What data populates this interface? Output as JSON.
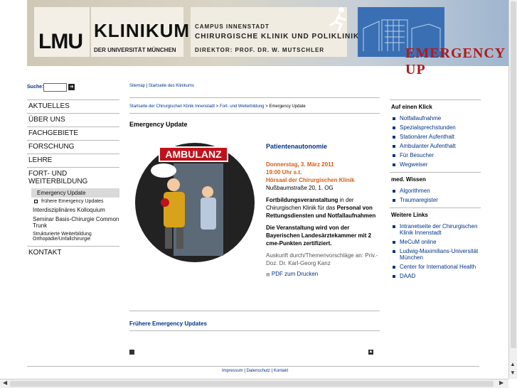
{
  "header": {
    "logo": "LMU",
    "klinikum": "KLINIKUM",
    "university": "DER UNIVERSITÄT MÜNCHEN",
    "campus": "CAMPUS INNENSTADT",
    "clinic": "CHIRURGISCHE KLINIK UND POLIKLINIK",
    "director": "DIREKTOR: PROF. DR. W. MUTSCHLER",
    "banner": "EMERGENCY UP"
  },
  "search": {
    "label": "Suche:",
    "value": ""
  },
  "nav": {
    "items": [
      "AKTUELLES",
      "ÜBER UNS",
      "FACHGEBIETE",
      "FORSCHUNG",
      "LEHRE",
      "FORT- UND WEITERBILDUNG"
    ],
    "sub": [
      "Emergency Update",
      "frühere Emergency Updates",
      "Interdisziplinäres Kolloquium",
      "Seminar Basis-Chirurgie Common Trunk",
      "Strukturierte Weiterbildung Orthopädie/Unfallchirurgie"
    ],
    "kontakt": "KONTAKT"
  },
  "toplinks": {
    "sitemap": "Sitemap",
    "sep": "|",
    "start": "Startseite des Klinikums"
  },
  "breadcrumb": {
    "a": "Startseite der Chirurgischen Klinik Innenstadt",
    "b": "Fort- und Weiterbildung",
    "c": "Emergency Update",
    "sep": ">"
  },
  "content": {
    "title": "Emergency Update",
    "image_label": "AMBULANZ",
    "heading": "Patientenautonomie",
    "date": "Donnerstag, 3. März 2011",
    "time": "19:00 Uhr s.t.",
    "place": "Hörsaal der Chirurgischen Klinik",
    "address": "Nußbaumstraße 20, 1. OG",
    "desc1": "Fortbildungsveranstaltung",
    "desc2": " in der Chirurgischen Klinik für das ",
    "desc3": "Personal von Rettungsdiensten und Notfallaufnahmen",
    "cert": "Die Veranstaltung wird von der Bayerischen Landesärztekammer mit 2 cme-Punkten zertifiziert.",
    "contact": "Auskunft durch/Themenvorschläge an: Priv.-Doz. Dr. Karl-Georg Kanz",
    "pdf": "PDF zum Drucken",
    "earlier": "Frühere Emergency Updates"
  },
  "sidebar": {
    "h1": "Auf einen Klick",
    "list1": [
      "Notfallaufnahme",
      "Spezialsprechstunden",
      "Stationärer Aufenthalt",
      "Ambulanter Aufenthalt",
      "Für Besucher",
      "Wegweiser"
    ],
    "h2": "med. Wissen",
    "list2": [
      "Algorithmen",
      "Traumaregister"
    ],
    "h3": "Weitere Links",
    "list3": [
      "Intranetseite der Chirurgischen Klinik Innenstadt",
      "MeCuM online",
      "Ludwig-Maximilians-Universität München",
      "Center for International Health",
      "DAAD"
    ]
  },
  "footer": {
    "impressum": "Impressum",
    "datenschutz": "Datenschutz",
    "kontakt": "Kontakt",
    "sep": "|"
  }
}
